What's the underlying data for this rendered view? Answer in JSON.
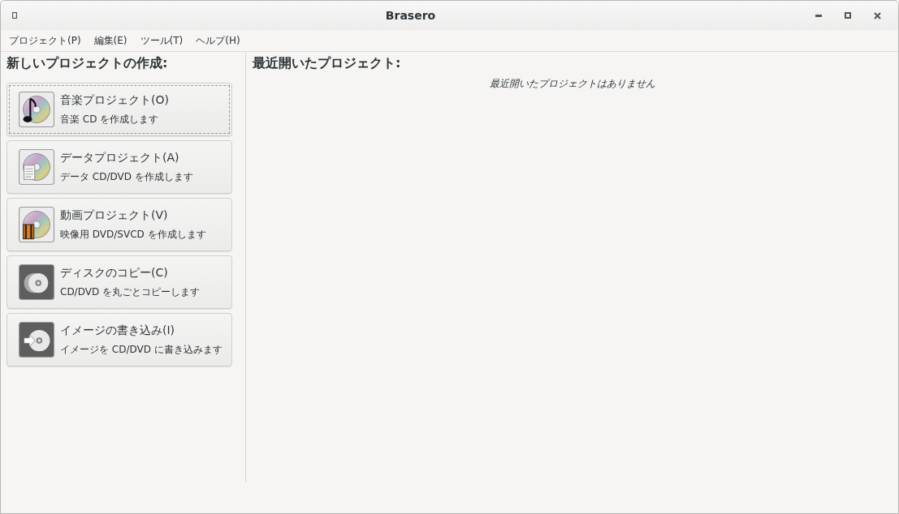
{
  "window": {
    "title": "Brasero"
  },
  "menu": [
    "プロジェクト(P)",
    "編集(E)",
    "ツール(T)",
    "ヘルプ(H)"
  ],
  "new_project": {
    "heading": "新しいプロジェクトの作成:",
    "items": [
      {
        "kind": "audio",
        "title": "音楽プロジェクト(O)",
        "description": "音楽 CD を作成します",
        "focused": true
      },
      {
        "kind": "data",
        "title": "データプロジェクト(A)",
        "description": "データ CD/DVD を作成します",
        "focused": false
      },
      {
        "kind": "video",
        "title": "動画プロジェクト(V)",
        "description": "映像用 DVD/SVCD を作成します",
        "focused": false
      },
      {
        "kind": "copy",
        "title": "ディスクのコピー(C)",
        "description": "CD/DVD を丸ごとコピーします",
        "focused": false
      },
      {
        "kind": "burn",
        "title": "イメージの書き込み(I)",
        "description": "イメージを CD/DVD に書き込みます",
        "focused": false
      }
    ]
  },
  "recent": {
    "heading": "最近開いたプロジェクト:",
    "empty_message": "最近開いたプロジェクトはありません"
  }
}
